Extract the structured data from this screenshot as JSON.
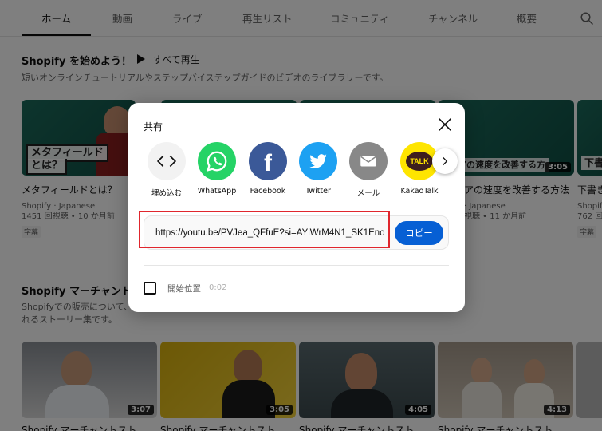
{
  "tabs": [
    {
      "label": "ホーム",
      "active": true
    },
    {
      "label": "動画"
    },
    {
      "label": "ライブ"
    },
    {
      "label": "再生リスト"
    },
    {
      "label": "コミュニティ"
    },
    {
      "label": "チャンネル"
    },
    {
      "label": "概要"
    }
  ],
  "section1": {
    "title": "Shopify を始めよう！",
    "play_all": "すべて再生",
    "description": "短いオンラインチュートリアルやステップバイステップガイドのビデオのライブラリーです。",
    "videos": [
      {
        "thumb_label_1": "メタフィールド",
        "thumb_label_2": "とは？",
        "title": "メタフィールドとは？",
        "channel": "Shopify · Japanese",
        "stats": "1451 回視聴 • 10 か月前",
        "badge": "字幕"
      },
      {
        "thumb_label": "アの速度を改善する方",
        "duration": "3:05",
        "title": "アの速度を改善する方法",
        "channel": "· Japanese",
        "stats": "視聴 • 11 か月前"
      },
      {
        "thumb_label": "下書",
        "title": "下書き",
        "channel": "Shopif",
        "stats": "762 回",
        "badge": "字幕"
      }
    ]
  },
  "section2": {
    "title": "Shopify マーチャントス",
    "description_1": "Shopifyでの販売について、",
    "description_2": "れるストーリー集です。",
    "videos": [
      {
        "duration": "3:07",
        "title": "Shopify マーチャントスト"
      },
      {
        "duration": "3:05",
        "title": "Shopify マーチャントスト"
      },
      {
        "duration": "4:05",
        "title": "Shopify マーチャントスト"
      },
      {
        "duration": "4:13",
        "title": "Shopify マーチャントスト"
      }
    ]
  },
  "share_dialog": {
    "title": "共有",
    "targets": [
      {
        "label": "埋め込む",
        "icon": "embed-code-icon",
        "color": "#f2f2f2"
      },
      {
        "label": "WhatsApp",
        "icon": "whatsapp-icon",
        "color": "#25d366"
      },
      {
        "label": "Facebook",
        "icon": "facebook-icon",
        "color": "#3b5998"
      },
      {
        "label": "Twitter",
        "icon": "twitter-icon",
        "color": "#1da1f2"
      },
      {
        "label": "メール",
        "icon": "mail-icon",
        "color": "#888888"
      },
      {
        "label": "KakaoTalk",
        "icon": "kakaotalk-icon",
        "color": "#fee500",
        "icon_text": "TALK"
      }
    ],
    "url": "https://youtu.be/PVJea_QFfuE?si=AYlWrM4N1_SK1Eno",
    "copy_label": "コピー",
    "start_at_label": "開始位置",
    "start_time": "0:02",
    "highlight_color": "#e0262d"
  }
}
